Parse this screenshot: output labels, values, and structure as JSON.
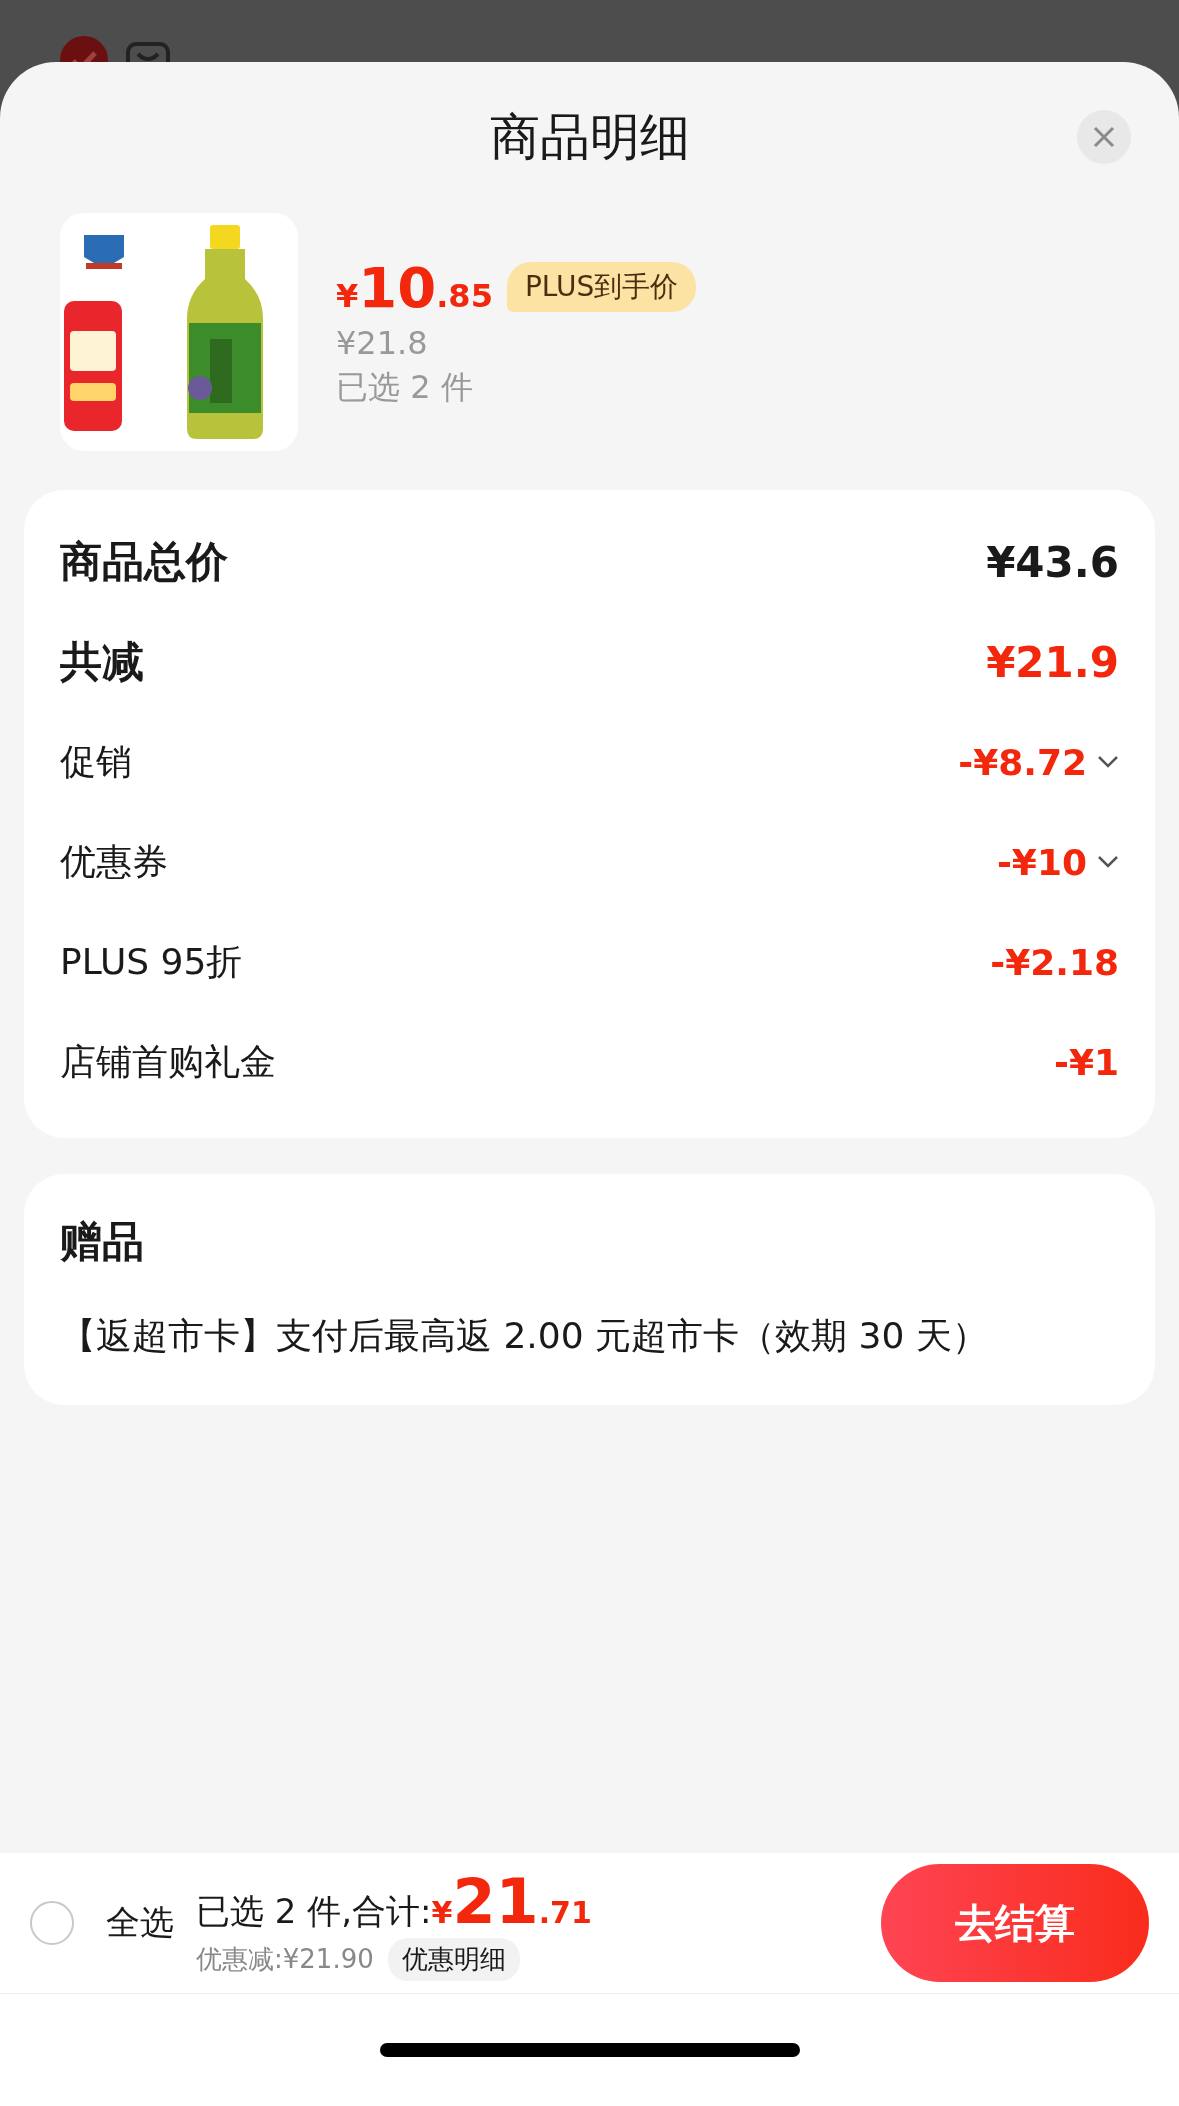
{
  "sheet": {
    "title": "商品明细"
  },
  "product": {
    "price": {
      "currency": "¥",
      "integer": "10",
      "decimal": ".85"
    },
    "badge": "PLUS到手价",
    "original_price": "¥21.8",
    "selected_count": "已选 2 件"
  },
  "summary": {
    "rows": [
      {
        "kind": "total",
        "label": "商品总价",
        "value": "¥43.6",
        "expandable": false
      },
      {
        "kind": "total_discount",
        "label": "共减",
        "value": "¥21.9",
        "expandable": false
      },
      {
        "kind": "discount",
        "label": "促销",
        "value": "-¥8.72",
        "expandable": true
      },
      {
        "kind": "discount",
        "label": "优惠券",
        "value": "-¥10",
        "expandable": true
      },
      {
        "kind": "discount",
        "label": "PLUS 95折",
        "value": "-¥2.18",
        "expandable": false
      },
      {
        "kind": "discount",
        "label": "店铺首购礼金",
        "value": "-¥1",
        "expandable": false
      }
    ]
  },
  "gifts": {
    "title": "赠品",
    "items": [
      "【返超市卡】支付后最高返 2.00 元超市卡（效期 30 天）"
    ]
  },
  "footer": {
    "select_all": {
      "label": "全选",
      "checked": false
    },
    "summary_label": "已选 2 件,合计:",
    "total": {
      "currency": "¥",
      "integer": "21",
      "decimal": ".71"
    },
    "savings": "优惠减:¥21.90",
    "details_button": "优惠明细",
    "checkout_button": "去结算"
  }
}
